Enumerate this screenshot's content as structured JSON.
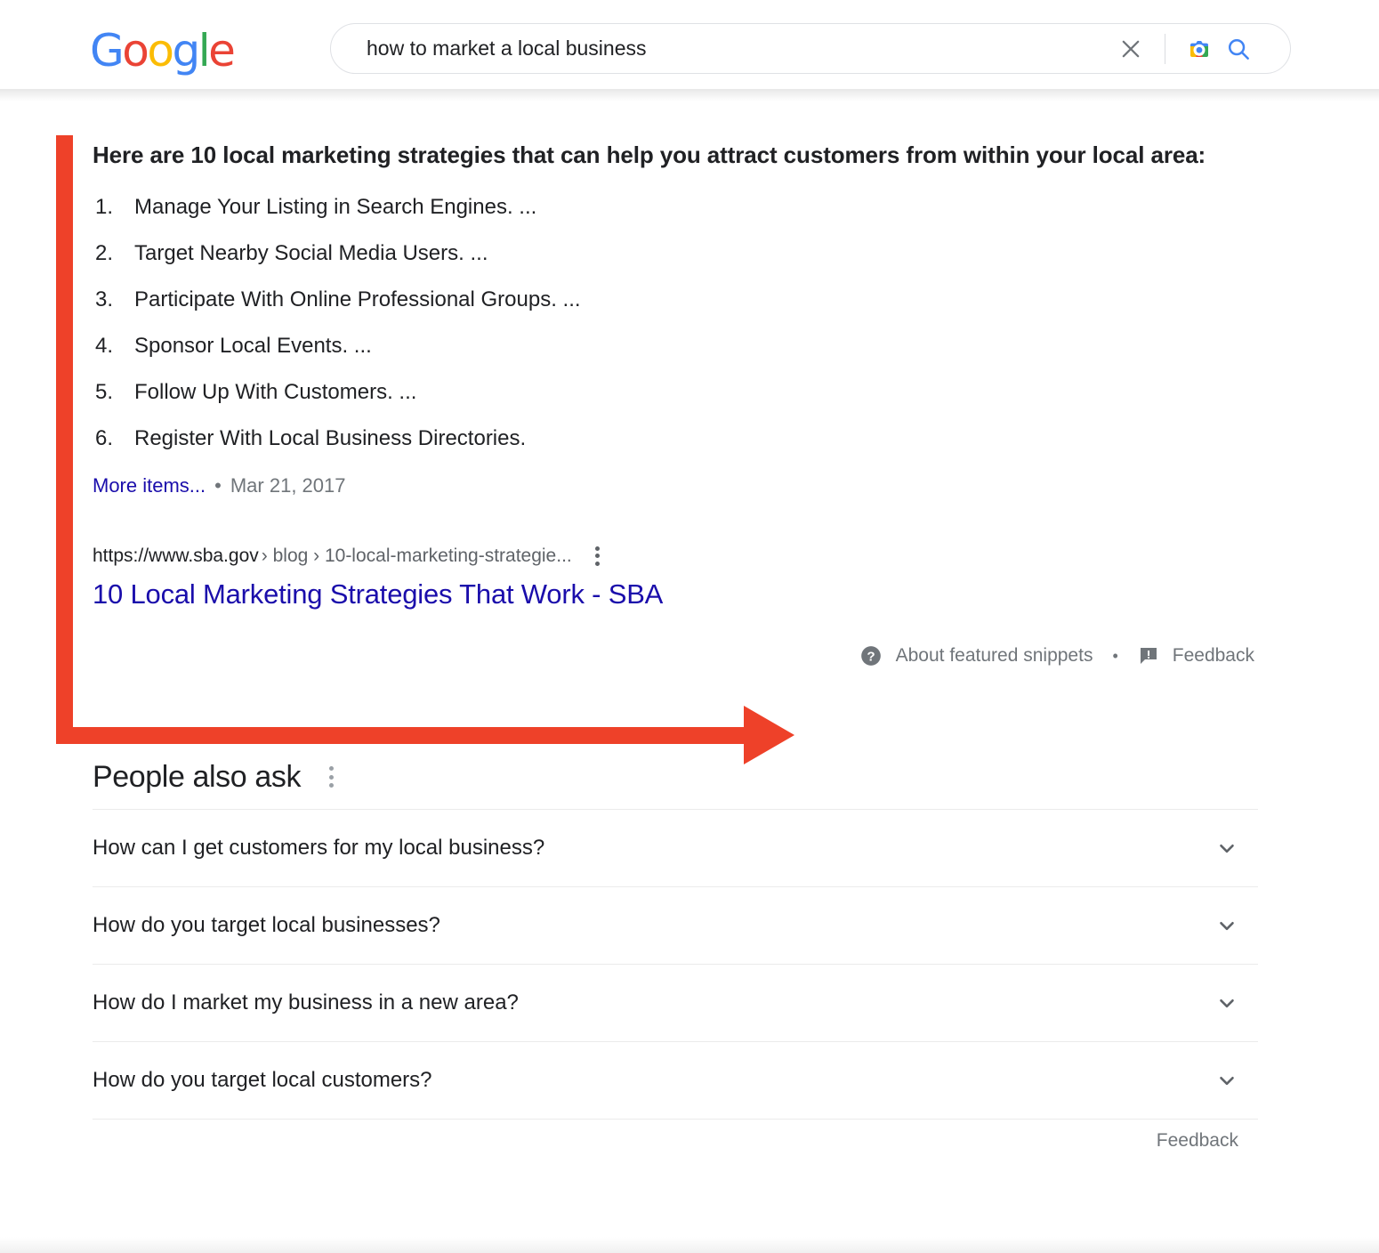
{
  "header": {
    "logo": {
      "letters": [
        {
          "char": "G",
          "color": "#4285F4"
        },
        {
          "char": "o",
          "color": "#EA4335"
        },
        {
          "char": "o",
          "color": "#FBBC05"
        },
        {
          "char": "g",
          "color": "#4285F4"
        },
        {
          "char": "l",
          "color": "#34A853"
        },
        {
          "char": "e",
          "color": "#EA4335"
        }
      ],
      "alt": "Google"
    },
    "search": {
      "value": "how to market a local business",
      "placeholder": "Search",
      "clear_icon": "close-icon",
      "lens_icon": "google-lens-camera-icon",
      "search_icon": "search-icon"
    }
  },
  "featured_snippet": {
    "heading": "Here are 10 local marketing strategies that can help you attract customers from within your local area:",
    "items": [
      "Manage Your Listing in Search Engines. ...",
      "Target Nearby Social Media Users. ...",
      "Participate With Online Professional Groups. ...",
      "Sponsor Local Events. ...",
      "Follow Up With Customers. ...",
      "Register With Local Business Directories."
    ],
    "more_items_label": "More items...",
    "separator": "•",
    "date": "Mar 21, 2017",
    "result": {
      "domain": "https://www.sba.gov",
      "path": "› blog › 10-local-marketing-strategie...",
      "kebab_icon": "three-dot-menu-icon",
      "title": "10 Local Marketing Strategies That Work - SBA"
    },
    "footer": {
      "about_icon": "question-mark-circle-icon",
      "about_label": "About featured snippets",
      "separator": "•",
      "feedback_icon": "feedback-flag-icon",
      "feedback_label": "Feedback"
    }
  },
  "annotation": {
    "color": "#EE4129",
    "shape": "l-shaped-arrow",
    "description": "red arrow pointing at About featured snippets"
  },
  "people_also_ask": {
    "title": "People also ask",
    "kebab_icon": "three-dot-menu-icon",
    "questions": [
      "How can I get customers for my local business?",
      "How do you target local businesses?",
      "How do I market my business in a new area?",
      "How do you target local customers?"
    ],
    "expand_icon": "chevron-down-icon",
    "feedback_label": "Feedback"
  }
}
